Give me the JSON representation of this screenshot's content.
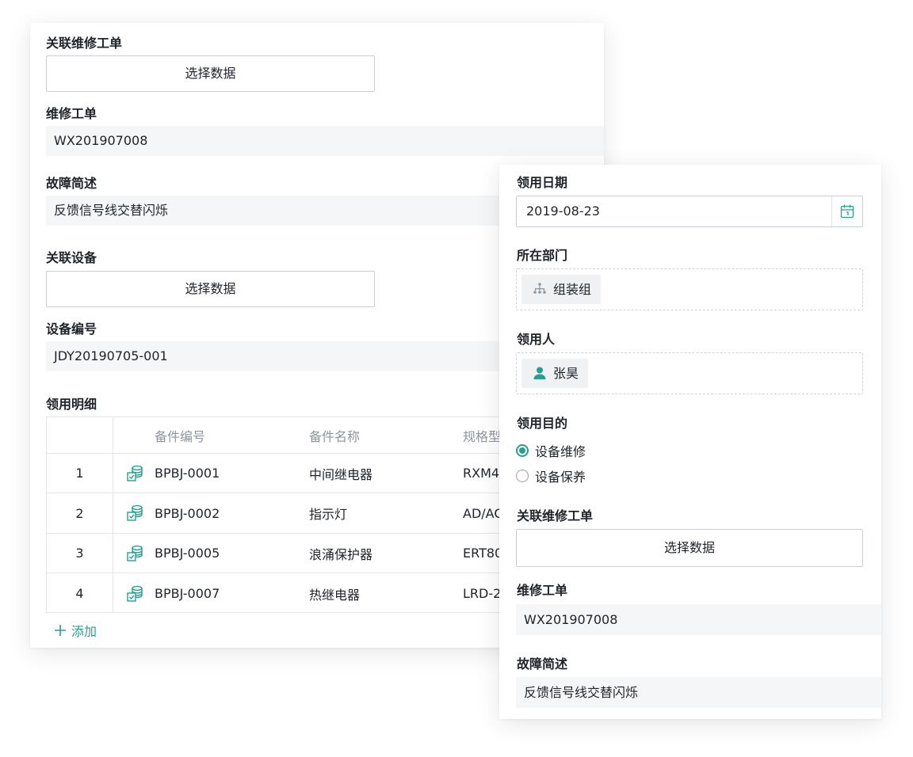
{
  "left_form": {
    "related_order": {
      "label": "关联维修工单",
      "button": "选择数据"
    },
    "repair_order": {
      "label": "维修工单",
      "value": "WX201907008"
    },
    "fault_desc": {
      "label": "故障简述",
      "value": "反馈信号线交替闪烁"
    },
    "related_device": {
      "label": "关联设备",
      "button": "选择数据"
    },
    "device_code": {
      "label": "设备编号",
      "value": "JDY20190705-001"
    },
    "detail": {
      "label": "领用明细",
      "columns": [
        "",
        "备件编号",
        "备件名称",
        "规格型"
      ],
      "rows": [
        {
          "index": "1",
          "code": "BPBJ-0001",
          "name": "中间继电器",
          "spec": "RXM4"
        },
        {
          "index": "2",
          "code": "BPBJ-0002",
          "name": "指示灯",
          "spec": "AD/AC"
        },
        {
          "index": "3",
          "code": "BPBJ-0005",
          "name": "浪涌保护器",
          "spec": "ERT80"
        },
        {
          "index": "4",
          "code": "BPBJ-0007",
          "name": "热继电器",
          "spec": "LRD-2"
        }
      ],
      "add_label": "添加"
    }
  },
  "right_form": {
    "date": {
      "label": "领用日期",
      "value": "2019-08-23"
    },
    "department": {
      "label": "所在部门",
      "value": "组装组"
    },
    "recipient": {
      "label": "领用人",
      "value": "张昊"
    },
    "purpose": {
      "label": "领用目的",
      "options": [
        {
          "label": "设备维修",
          "selected": true
        },
        {
          "label": "设备保养",
          "selected": false
        }
      ]
    },
    "related_order": {
      "label": "关联维修工单",
      "button": "选择数据"
    },
    "repair_order": {
      "label": "维修工单",
      "value": "WX201907008"
    },
    "fault_desc": {
      "label": "故障简述",
      "value": "反馈信号线交替闪烁"
    }
  },
  "colors": {
    "accent": "#25a08e",
    "field_bg": "#f5f6f7",
    "border": "#c9cdd4"
  },
  "icons": {
    "part": "database-check-icon",
    "date": "calendar-icon",
    "dept": "org-tree-icon",
    "user": "user-icon",
    "add": "plus-icon"
  }
}
